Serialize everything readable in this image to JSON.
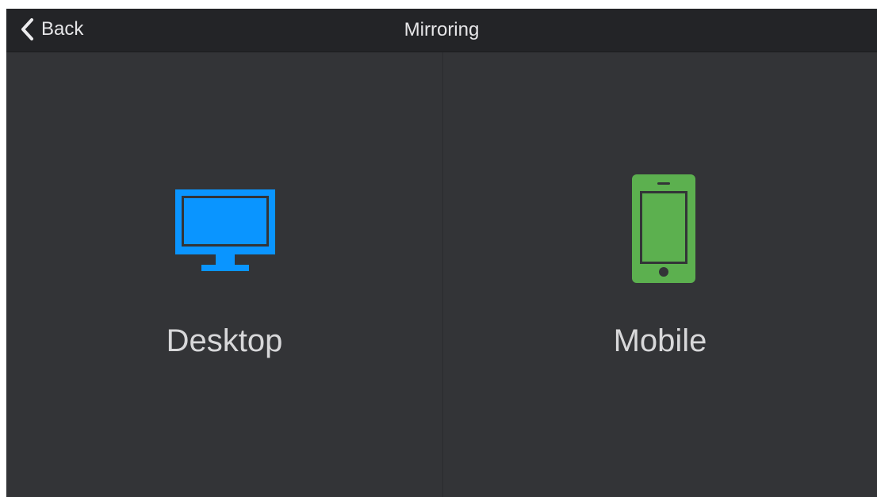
{
  "header": {
    "back_label": "Back",
    "title": "Mirroring"
  },
  "options": [
    {
      "label": "Desktop",
      "icon": "desktop-monitor-icon",
      "color": "#0a95ff"
    },
    {
      "label": "Mobile",
      "icon": "mobile-phone-icon",
      "color": "#5cb04f"
    }
  ]
}
